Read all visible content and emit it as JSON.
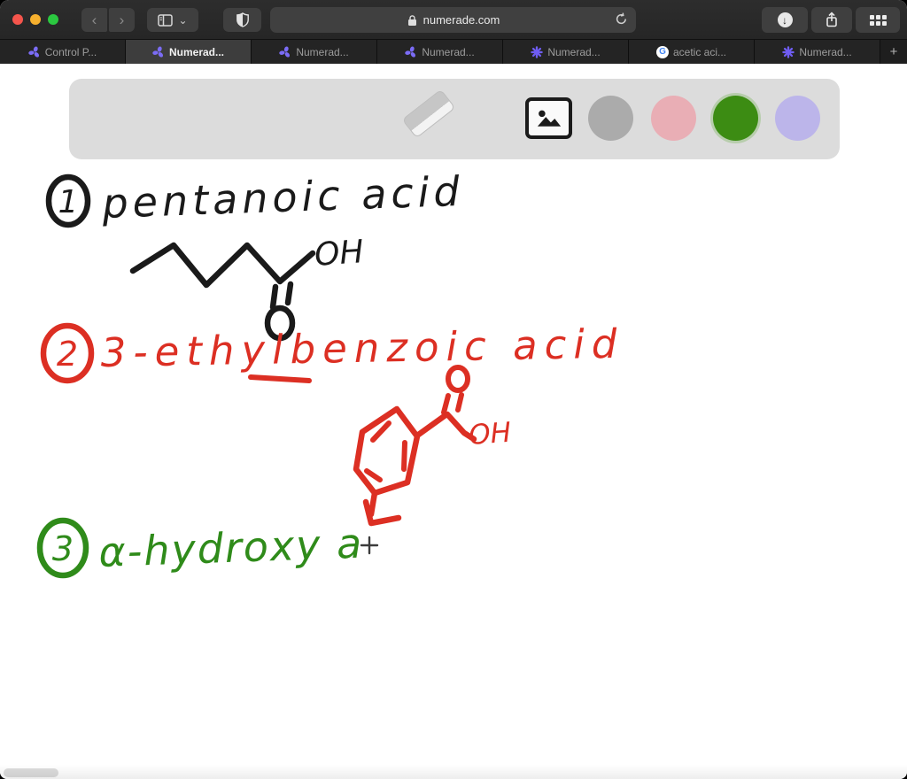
{
  "browser": {
    "address": "numerade.com",
    "window_controls": [
      "close",
      "minimize",
      "zoom"
    ]
  },
  "icons": {
    "back": "‹",
    "forward": "›",
    "chevron_down": "⌄",
    "download_arrow": "↓",
    "new_tab": "+",
    "google_g": "G"
  },
  "tabs": [
    {
      "label": "Control P...",
      "favicon": "numerade-pinwheel",
      "active": false
    },
    {
      "label": "Numerad...",
      "favicon": "numerade-pinwheel",
      "active": true
    },
    {
      "label": "Numerad...",
      "favicon": "numerade-pinwheel",
      "active": false
    },
    {
      "label": "Numerad...",
      "favicon": "numerade-pinwheel",
      "active": false
    },
    {
      "label": "Numerad...",
      "favicon": "numerade-starburst",
      "active": false
    },
    {
      "label": "acetic aci...",
      "favicon": "google",
      "active": false
    },
    {
      "label": "Numerad...",
      "favicon": "numerade-starburst",
      "active": false
    }
  ],
  "whiteboard": {
    "toolbar": {
      "tools": [
        "eraser",
        "insert-image"
      ],
      "color_swatches": [
        {
          "name": "gray",
          "hex": "#ababab",
          "selected": false
        },
        {
          "name": "pink",
          "hex": "#e9aeb5",
          "selected": false
        },
        {
          "name": "green",
          "hex": "#3c8c13",
          "selected": true
        },
        {
          "name": "purple",
          "hex": "#bcb5ea",
          "selected": false
        }
      ]
    },
    "annotations": {
      "item1": {
        "number": "1",
        "label": "pentanoic acid",
        "ink": "#1a1a1a",
        "oh": "OH",
        "drawing": "skeletal zig-zag carbon chain with C=O double bond and OH"
      },
      "item2": {
        "number": "2",
        "label": "3-ethylbenzoic acid",
        "ink": "#dc2f23",
        "oh": "OH",
        "drawing": "benzene ring with carboxylic acid group and ethyl substituent"
      },
      "item3": {
        "number": "3",
        "label": "α-hydroxy a",
        "ink": "#2f8b1a",
        "drawing": "unfinished line, crosshair cursor after last letter"
      }
    }
  }
}
